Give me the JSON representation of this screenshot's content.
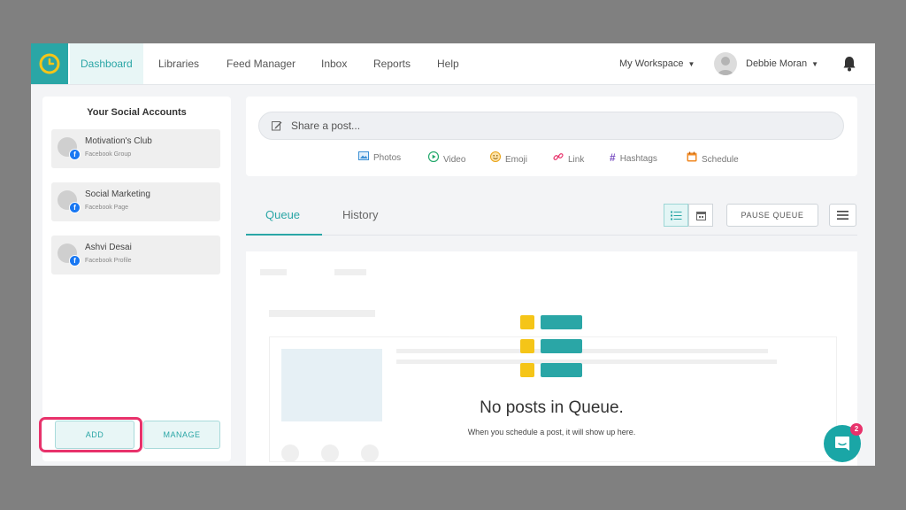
{
  "nav": {
    "items": [
      "Dashboard",
      "Libraries",
      "Feed Manager",
      "Inbox",
      "Reports",
      "Help"
    ],
    "workspace": "My Workspace",
    "user": "Debbie Moran"
  },
  "sidebar": {
    "title": "Your Social Accounts",
    "accounts": [
      {
        "name": "Motivation's Club",
        "type": "Facebook Group"
      },
      {
        "name": "Social Marketing",
        "type": "Facebook Page"
      },
      {
        "name": "Ashvi Desai",
        "type": "Facebook Profile"
      }
    ],
    "add_label": "ADD",
    "manage_label": "MANAGE"
  },
  "composer": {
    "placeholder": "Share a post...",
    "tools": [
      "Photos",
      "Video",
      "Emoji",
      "Link",
      "Hashtags",
      "Schedule"
    ]
  },
  "tabs": [
    "Queue",
    "History"
  ],
  "toolbar": {
    "pause_label": "PAUSE QUEUE"
  },
  "queue": {
    "empty_title": "No posts in Queue.",
    "empty_subtitle": "When you schedule a post, it will show up here."
  },
  "chat": {
    "badge": "2"
  },
  "colors": {
    "accent": "#2aa6a6",
    "highlight": "#e8326b",
    "icon_yellow": "#f5c518"
  }
}
